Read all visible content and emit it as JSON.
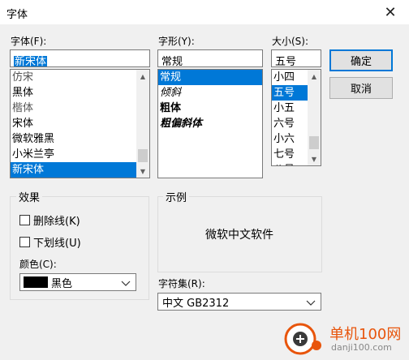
{
  "dialog": {
    "title": "字体",
    "close_glyph": "✕"
  },
  "font": {
    "label": "字体(F):",
    "value": "新宋体",
    "items": [
      "仿宋",
      "黑体",
      "楷体",
      "宋体",
      "微软雅黑",
      "小米兰亭",
      "新宋体"
    ],
    "selected_index": 6
  },
  "style": {
    "label": "字形(Y):",
    "value": "常规",
    "items": [
      "常规",
      "倾斜",
      "粗体",
      "粗偏斜体"
    ],
    "selected_index": 0
  },
  "size": {
    "label": "大小(S):",
    "value": "五号",
    "items": [
      "小四",
      "五号",
      "小五",
      "六号",
      "小六",
      "七号",
      "八号"
    ],
    "selected_index": 1
  },
  "buttons": {
    "ok": "确定",
    "cancel": "取消"
  },
  "effects": {
    "title": "效果",
    "strikeout": "删除线(K)",
    "underline": "下划线(U)",
    "color_label": "颜色(C):",
    "color_value": "黑色",
    "color_swatch": "#000000"
  },
  "sample": {
    "title": "示例",
    "text": "微软中文软件"
  },
  "charset": {
    "label": "字符集(R):",
    "value": "中文 GB2312"
  },
  "watermark": {
    "name": "单机100网",
    "url": "danji100.com"
  },
  "colors": {
    "accent": "#0078d7",
    "watermark": "#e8550c"
  }
}
